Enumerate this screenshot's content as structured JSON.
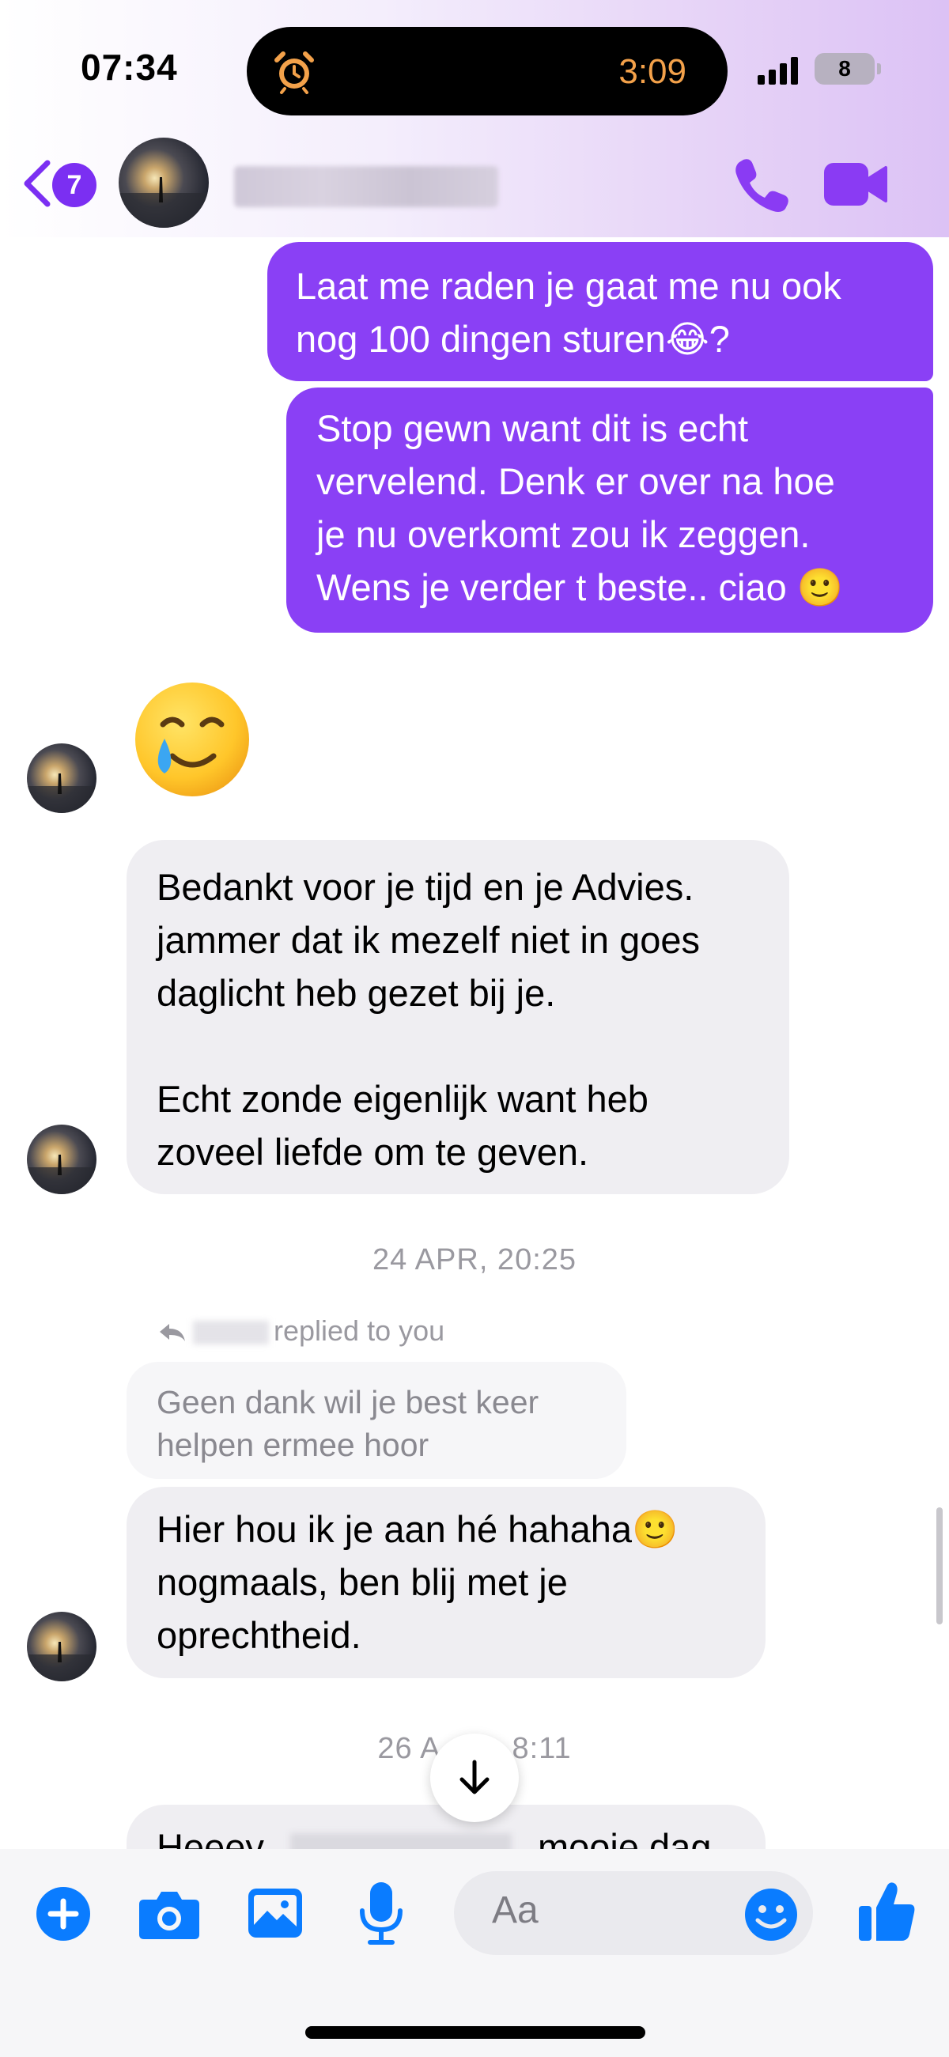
{
  "status_bar": {
    "time": "07:34",
    "island_timer": "3:09",
    "battery": "8"
  },
  "header": {
    "unread_badge": "7",
    "contact_name": "",
    "icons": [
      "back-chevron-icon",
      "phone-icon",
      "video-camera-icon"
    ],
    "accent_color": "#7b2ff2"
  },
  "messages": {
    "out_1": {
      "lines": [
        "Laat me raden je gaat me nu ook",
        "nog 100 dingen sturen😂?"
      ]
    },
    "out_2": {
      "lines": [
        "Stop gewn want dit is echt",
        "vervelend. Denk er over na hoe",
        "je nu overkomt zou ik zeggen.",
        "Wens je verder t beste.. ciao 🙂"
      ]
    },
    "in_emoji": "🥲",
    "in_1": {
      "lines": [
        "Bedankt voor je tijd en je Advies.",
        "jammer dat ik mezelf niet in goes",
        "daglicht heb gezet bij je.",
        "",
        "Echt zonde eigenlijk want heb",
        "zoveel liefde om te geven."
      ]
    },
    "timestamp_1": "24 APR, 20:25",
    "reply_note": "replied to you",
    "quoted": {
      "lines": [
        "Geen dank wil je best keer",
        "helpen ermee hoor"
      ]
    },
    "in_2": {
      "lines": [
        "Hier hou ik je aan hé hahaha🙂",
        "nogmaals, ben blij met je",
        "oprechtheid."
      ]
    },
    "timestamp_2_left": "26 A",
    "timestamp_2_right": "8:11",
    "in_3_partial": {
      "start": "Heeey",
      "end": "mooie dag"
    },
    "outgoing_color": "#8a40f5",
    "incoming_color": "#efeef2"
  },
  "composer": {
    "placeholder": "Aa",
    "icons": [
      "plus-icon",
      "camera-icon",
      "gallery-icon",
      "microphone-icon",
      "emoji-icon",
      "thumbs-up-icon"
    ],
    "accent_color": "#0a7cff"
  }
}
